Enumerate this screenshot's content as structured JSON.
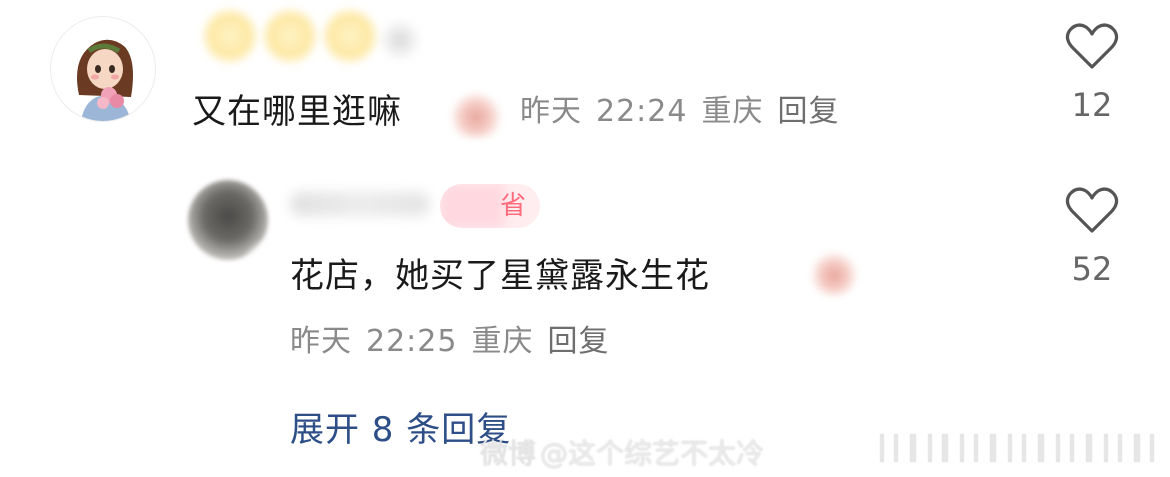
{
  "comment_main": {
    "text_visible": "又在哪里逛嘛",
    "meta_time_partial": "昨天",
    "meta_clock": "22:24",
    "meta_location": "重庆",
    "reply_label": "回复",
    "likes": "12"
  },
  "reply_comment": {
    "badge_partial": "省",
    "text": "花店，她买了星黛露永生花",
    "meta_time": "昨天",
    "meta_clock": "22:25",
    "meta_location": "重庆",
    "reply_label": "回复",
    "likes": "52"
  },
  "expand_replies": {
    "label": "展开 8 条回复"
  },
  "watermark": {
    "logo": "微博",
    "handle": "@这个综艺不太冷"
  },
  "colors": {
    "text": "#1a1a1a",
    "meta": "#8a8a8a",
    "expand_link": "#2d4e87",
    "like_icon": "#555555"
  },
  "icons": [
    "heart-outline-icon",
    "heart-outline-icon",
    "weibo-logo-icon"
  ]
}
